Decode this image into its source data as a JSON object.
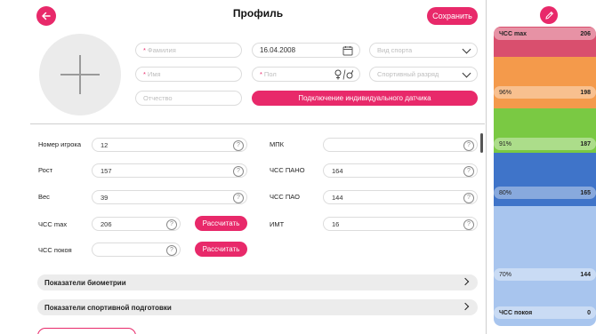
{
  "header": {
    "title": "Профиль",
    "save_label": "Сохранить"
  },
  "profile": {
    "lastname_placeholder": "Фамилия",
    "firstname_placeholder": "Имя",
    "patronymic_placeholder": "Отчество",
    "birthdate": "16.04.2008",
    "gender_placeholder": "Пол",
    "sport_placeholder": "Вид спорта",
    "rank_placeholder": "Спортивный разряд",
    "sensor_button": "Подключение индивидуального датчика"
  },
  "metrics": {
    "player_number": {
      "label": "Номер игрока",
      "value": "12"
    },
    "height": {
      "label": "Рост",
      "value": "157"
    },
    "weight": {
      "label": "Вес",
      "value": "39"
    },
    "hr_max": {
      "label": "ЧСС max",
      "value": "206"
    },
    "hr_rest": {
      "label": "ЧСС покоя",
      "value": ""
    },
    "mpk": {
      "label": "МПК",
      "value": ""
    },
    "hr_pano": {
      "label": "ЧСС ПАНО",
      "value": "164"
    },
    "hr_pao": {
      "label": "ЧСС ПАО",
      "value": "144"
    },
    "bmi": {
      "label": "ИМТ",
      "value": "16"
    },
    "calc_label": "Рассчитать",
    "help_glyph": "?"
  },
  "sections": [
    {
      "label": "Показатели биометрии"
    },
    {
      "label": "Показатели спортивной подготовки"
    }
  ],
  "zones": [
    {
      "label": "ЧСС max",
      "value": "206",
      "color": "#d94f6e",
      "bold": true
    },
    {
      "label": "96%",
      "value": "198",
      "color": "#f49a4b",
      "bold": false
    },
    {
      "label": "91%",
      "value": "187",
      "color": "#7ac943",
      "bold": false
    },
    {
      "label": "80%",
      "value": "165",
      "color": "#3f74c9",
      "bold": false
    },
    {
      "label": "70%",
      "value": "144",
      "color": "#a8c5ee",
      "bold": false
    },
    {
      "label": "ЧСС покоя",
      "value": "0",
      "color": "#a8c5ee",
      "bold": true
    }
  ],
  "colors": {
    "accent": "#e8296a"
  }
}
